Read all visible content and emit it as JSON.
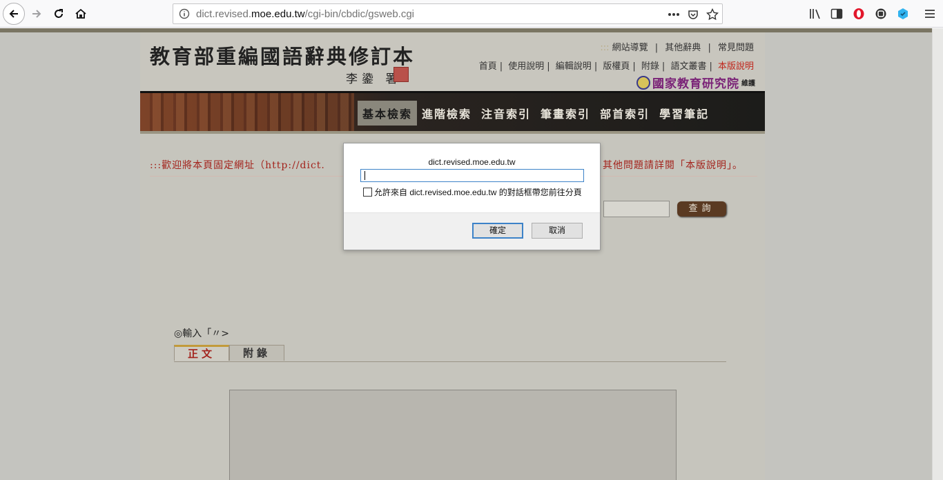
{
  "browser": {
    "url_prefix": "dict.revised.",
    "url_domain": "moe.edu.tw",
    "url_path": "/cgi-bin/cbdic/gsweb.cgi",
    "icons": [
      "back-icon",
      "forward-icon",
      "reload-icon",
      "home-icon",
      "info-icon",
      "more-icon",
      "pocket-icon",
      "bookmark-star-icon",
      "library-icon",
      "sidebar-icon",
      "opera-icon",
      "extension-icon",
      "extension2-icon",
      "menu-icon"
    ]
  },
  "site": {
    "title": "教育部重編國語辭典修訂本",
    "signature": "李鍌 署",
    "toplinks_dots": ":::",
    "toplinks": [
      "網站導覽",
      "其他辭典",
      "常見問題"
    ],
    "sublinks": [
      "首頁",
      "使用說明",
      "編輯說明",
      "版權頁",
      "附錄",
      "語文叢書"
    ],
    "sublink_highlight": "本版說明",
    "publisher": "國家教育研究院",
    "publisher_tail": "維護"
  },
  "menu": {
    "items": [
      "基本檢索",
      "進階檢索",
      "注音索引",
      "筆畫索引",
      "部首索引",
      "學習筆記"
    ]
  },
  "main": {
    "welcome_left": ":::歡迎將本頁固定網址（http://dict.",
    "welcome_right": "其他問題請詳閱「本版說明」。",
    "search_button": "查詢",
    "input_label": "◎輸入「〃>",
    "tabs": [
      "正文",
      "附錄"
    ]
  },
  "dialog": {
    "title": "dict.revised.moe.edu.tw",
    "input_value": "",
    "checkbox_label": "允許來自 dict.revised.moe.edu.tw 的對話框帶您前往分頁",
    "ok_label": "確定",
    "cancel_label": "取消"
  },
  "colors": {
    "accent_red": "#a3231c",
    "dialog_focus": "#3c82c8",
    "page_bg": "#c4c4bf"
  }
}
